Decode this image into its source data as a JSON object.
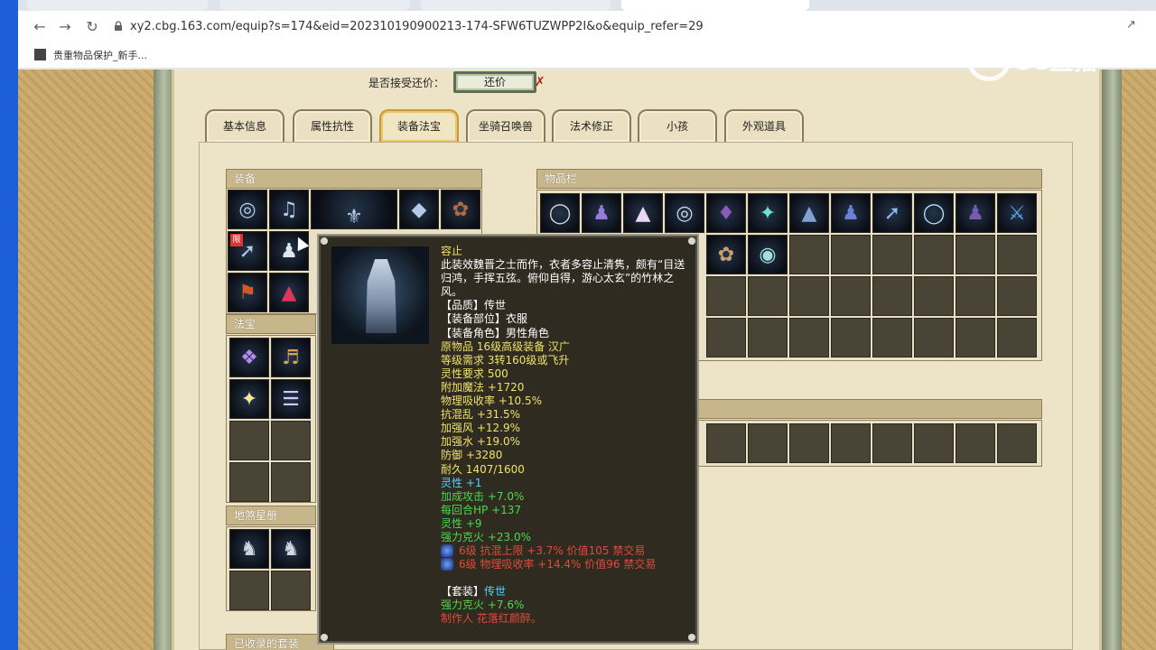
{
  "browser": {
    "url": "xy2.cbg.163.com/equip?s=174&eid=202310190900213-174-SFW6TUZWPP2I&o&equip_refer=29",
    "bookmark": "贵重物品保护_新手..."
  },
  "watermark": "CC直播",
  "page": {
    "bargain_label": "是否接受还价：",
    "bargain_button": "还价",
    "tabs": [
      "基本信息",
      "属性抗性",
      "装备法宝",
      "坐骑召唤兽",
      "法术修正",
      "小孩",
      "外观道具"
    ],
    "active_tab": "装备法宝",
    "sections": {
      "equipment": "装备",
      "inventory": "物品栏",
      "fabao": "法宝",
      "dishasr": "地煞星册",
      "collected_sets": "已收录的套装"
    },
    "equip_badge": "限"
  },
  "tooltip": {
    "name": "容止",
    "desc": "此装效魏晋之士而作，衣者多容止清隽，颇有“目送归鸿，手挥五弦。俯仰自得，游心太玄”的竹林之风。",
    "quality": "【品质】传世",
    "slot": "【装备部位】衣服",
    "role": "【装备角色】男性角色",
    "origin": "原物品 16级高级装备 汉广",
    "level_req": "等级需求 3转160级或飞升",
    "spirit_req": "灵性要求 500",
    "stats_yellow": [
      "附加魔法 +1720",
      "物理吸收率 +10.5%",
      "抗混乱 +31.5%",
      "加强风 +12.9%",
      "加强水 +19.0%",
      "防御 +3280",
      "耐久 1407/1600"
    ],
    "spirit": "灵性 +1",
    "stats_green": [
      "加成攻击 +7.0%",
      "每回合HP +137",
      "灵性 +9",
      "强力克火 +23.0%"
    ],
    "gems": [
      "6级 抗混上限 +3.7% 价值105 禁交易",
      "6级 物理吸收率 +14.4% 价值96 禁交易"
    ],
    "set_label": "【套装】",
    "set_name": "传世",
    "set_bonus": "强力克火 +7.6%",
    "maker": "制作人 花落红颜醉。"
  },
  "colors": {
    "tooltip_bg": "#2f2b20",
    "yellow": "#f0e26b",
    "green": "#4cd94c",
    "cyan": "#4fd4ff",
    "red": "#e04b3a"
  }
}
